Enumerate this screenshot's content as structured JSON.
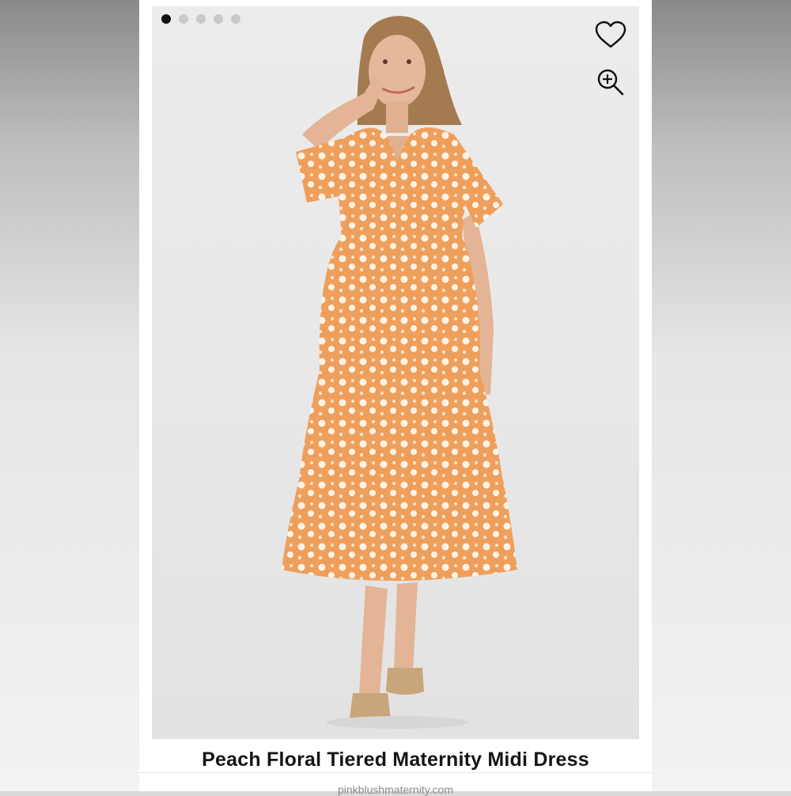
{
  "product": {
    "title": "Peach Floral Tiered Maternity Midi Dress",
    "subtitle_partial": "pinkblushmaternity.com"
  },
  "gallery": {
    "image_count": 5,
    "active_index": 0,
    "image_alt": "Model wearing peach floral tiered maternity midi dress"
  },
  "icons": {
    "favorite": "heart-icon",
    "zoom": "zoom-in-icon"
  },
  "colors": {
    "dress": "#f0a86a",
    "flowers": "#fff3e6",
    "active_dot": "#111111",
    "inactive_dot": "#c9c9c9"
  }
}
